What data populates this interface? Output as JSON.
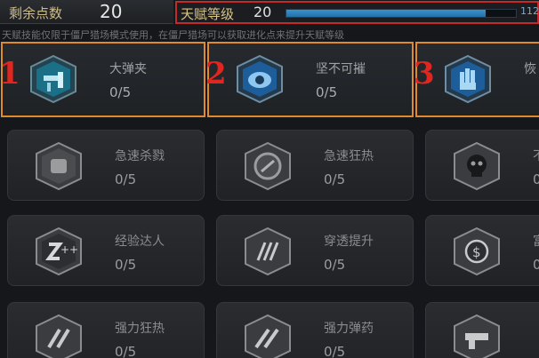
{
  "header": {
    "points_label": "剩余点数",
    "points_value": "20",
    "talent_level_label": "天赋等级",
    "talent_level_value": "20",
    "progress_text": "112",
    "progress_fraction": 0.87
  },
  "notice": "天赋技能仅限于僵尸猎场模式使用，在僵尸猎场可以获取进化点来提升天赋等级",
  "cards": [
    {
      "marker": "1",
      "name": "大弹夹",
      "level": "0/5",
      "icon": "ammo-clip-icon",
      "state": "active"
    },
    {
      "marker": "2",
      "name": "坚不可摧",
      "level": "0/5",
      "icon": "shield-icon",
      "state": "active"
    },
    {
      "marker": "3",
      "name": "恢",
      "level": "",
      "icon": "hand-icon",
      "state": "active"
    },
    {
      "name": "急速杀戮",
      "level": "0/5",
      "icon": "fist-icon",
      "state": "locked"
    },
    {
      "name": "急速狂热",
      "level": "0/5",
      "icon": "speed-icon",
      "state": "locked"
    },
    {
      "name": "不",
      "level": "0",
      "icon": "skull-icon",
      "state": "locked"
    },
    {
      "name": "经验达人",
      "level": "0/5",
      "icon": "exp-plus-icon",
      "state": "locked"
    },
    {
      "name": "穿透提升",
      "level": "0/5",
      "icon": "claw-icon",
      "state": "locked"
    },
    {
      "name": "富",
      "level": "0",
      "icon": "coin-icon",
      "state": "locked"
    },
    {
      "name": "强力狂热",
      "level": "0/5",
      "icon": "power-fever-icon",
      "state": "locked"
    },
    {
      "name": "强力弹药",
      "level": "0/5",
      "icon": "power-ammo-icon",
      "state": "locked"
    },
    {
      "name": "",
      "level": "",
      "icon": "gun-icon",
      "state": "locked"
    }
  ],
  "colors": {
    "accent_blue": "#2f86c4",
    "highlight_orange": "#e08a2e",
    "marker_red": "#e0261e",
    "header_red": "#c42a2a"
  }
}
